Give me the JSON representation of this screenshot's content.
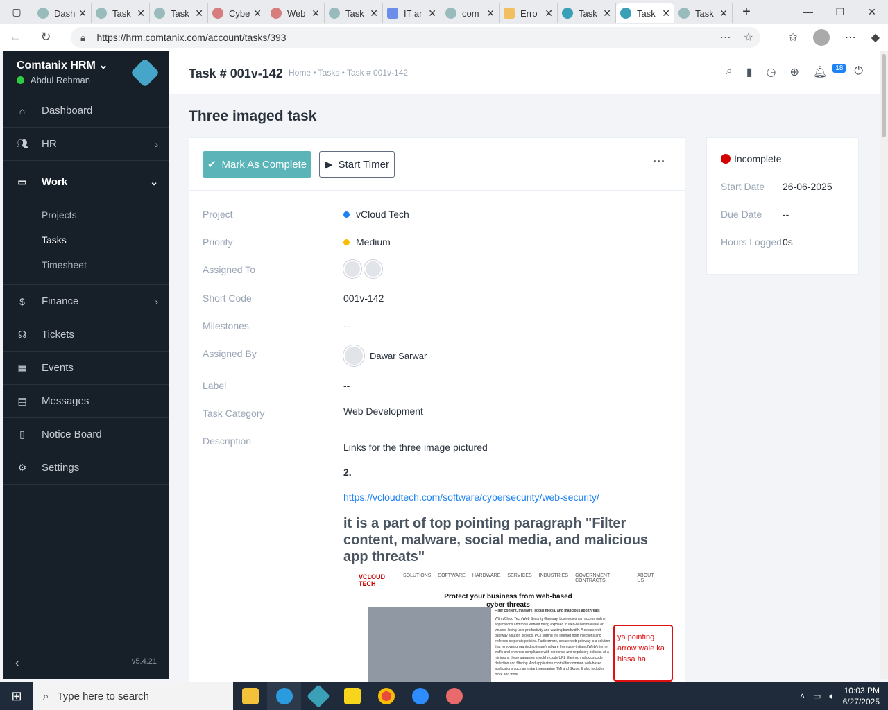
{
  "browser": {
    "tabs": [
      {
        "title": "Dash"
      },
      {
        "title": "Task"
      },
      {
        "title": "Task"
      },
      {
        "title": "Cybe"
      },
      {
        "title": "Web"
      },
      {
        "title": "Task"
      },
      {
        "title": "IT ar"
      },
      {
        "title": "com"
      },
      {
        "title": "Erro"
      },
      {
        "title": "Task"
      },
      {
        "title": "Task"
      },
      {
        "title": "Task"
      }
    ],
    "url": "https://hrm.comtanix.com/account/tasks/393"
  },
  "sidebar": {
    "brand": "Comtanix HRM",
    "user": "Abdul Rehman",
    "items": {
      "dashboard": "Dashboard",
      "hr": "HR",
      "work": "Work",
      "projects": "Projects",
      "tasks": "Tasks",
      "timesheet": "Timesheet",
      "finance": "Finance",
      "tickets": "Tickets",
      "events": "Events",
      "messages": "Messages",
      "notice_board": "Notice Board",
      "settings": "Settings"
    },
    "finance_icon": "$",
    "version": "v5.4.21"
  },
  "header": {
    "title": "Task # 001v-142",
    "breadcrumb": "Home • Tasks • Task # 001v-142",
    "notification_count": "18"
  },
  "task": {
    "name": "Three imaged task",
    "mark_complete": "Mark As Complete",
    "start_timer": "Start Timer",
    "labels": {
      "project": "Project",
      "priority": "Priority",
      "assigned_to": "Assigned To",
      "short_code": "Short Code",
      "milestones": "Milestones",
      "assigned_by": "Assigned By",
      "label": "Label",
      "category": "Task Category",
      "description": "Description"
    },
    "values": {
      "project": "vCloud Tech",
      "priority": "Medium",
      "short_code": "001v-142",
      "milestones": "--",
      "assigned_by": "Dawar Sarwar",
      "label": "--",
      "category": "Web Development"
    },
    "colors": {
      "project_dot": "#1d82f5",
      "priority_dot": "#fcbd01"
    },
    "description": {
      "line1": "Links for the three image pictured",
      "line2": "2.",
      "link": "https://vcloudtech.com/software/cybersecurity/web-security/",
      "heading": "it is a part of top pointing paragraph \"Filter content, malware, social media, and malicious app threats\""
    },
    "screenshot": {
      "logo": "VCLOUD TECH",
      "nav": [
        "SOLUTIONS",
        "SOFTWARE",
        "HARDWARE",
        "SERVICES",
        "INDUSTRIES",
        "GOVERNMENT CONTRACTS",
        "ABOUT US"
      ],
      "title": "Protect your business from web-based cyber threats",
      "subtitle": "Filter content, malware, social media, and malicious app threats",
      "body": "With vCloud Tech Web Security Gateway, businesses can access online applications and tools without being exposed to web-based malware or viruses, losing user productivity and wasting bandwidth. A secure web gateway solution protects PCs surfing the internet from infections and enforces corporate policies. Furthermore, secure web gateway is a solution that removes unwanted software/malware from user-initiated Web/Internet traffic and enforces compliance with corporate and regulatory policies. At a minimum, these gateways should include URL filtering, malicious code detection and filtering. And application control for common web-based applications such as instant messaging (IM) and Skype. It also includes more and more",
      "note": "ya pointing arrow wale ka hissa ha"
    }
  },
  "side": {
    "status": "Incomplete",
    "start_label": "Start Date",
    "start_value": "26-06-2025",
    "due_label": "Due Date",
    "due_value": "--",
    "hours_label": "Hours Logged",
    "hours_value": "0s"
  },
  "taskbar": {
    "search_placeholder": "Type here to search",
    "time": "10:03 PM",
    "date": "6/27/2025"
  }
}
